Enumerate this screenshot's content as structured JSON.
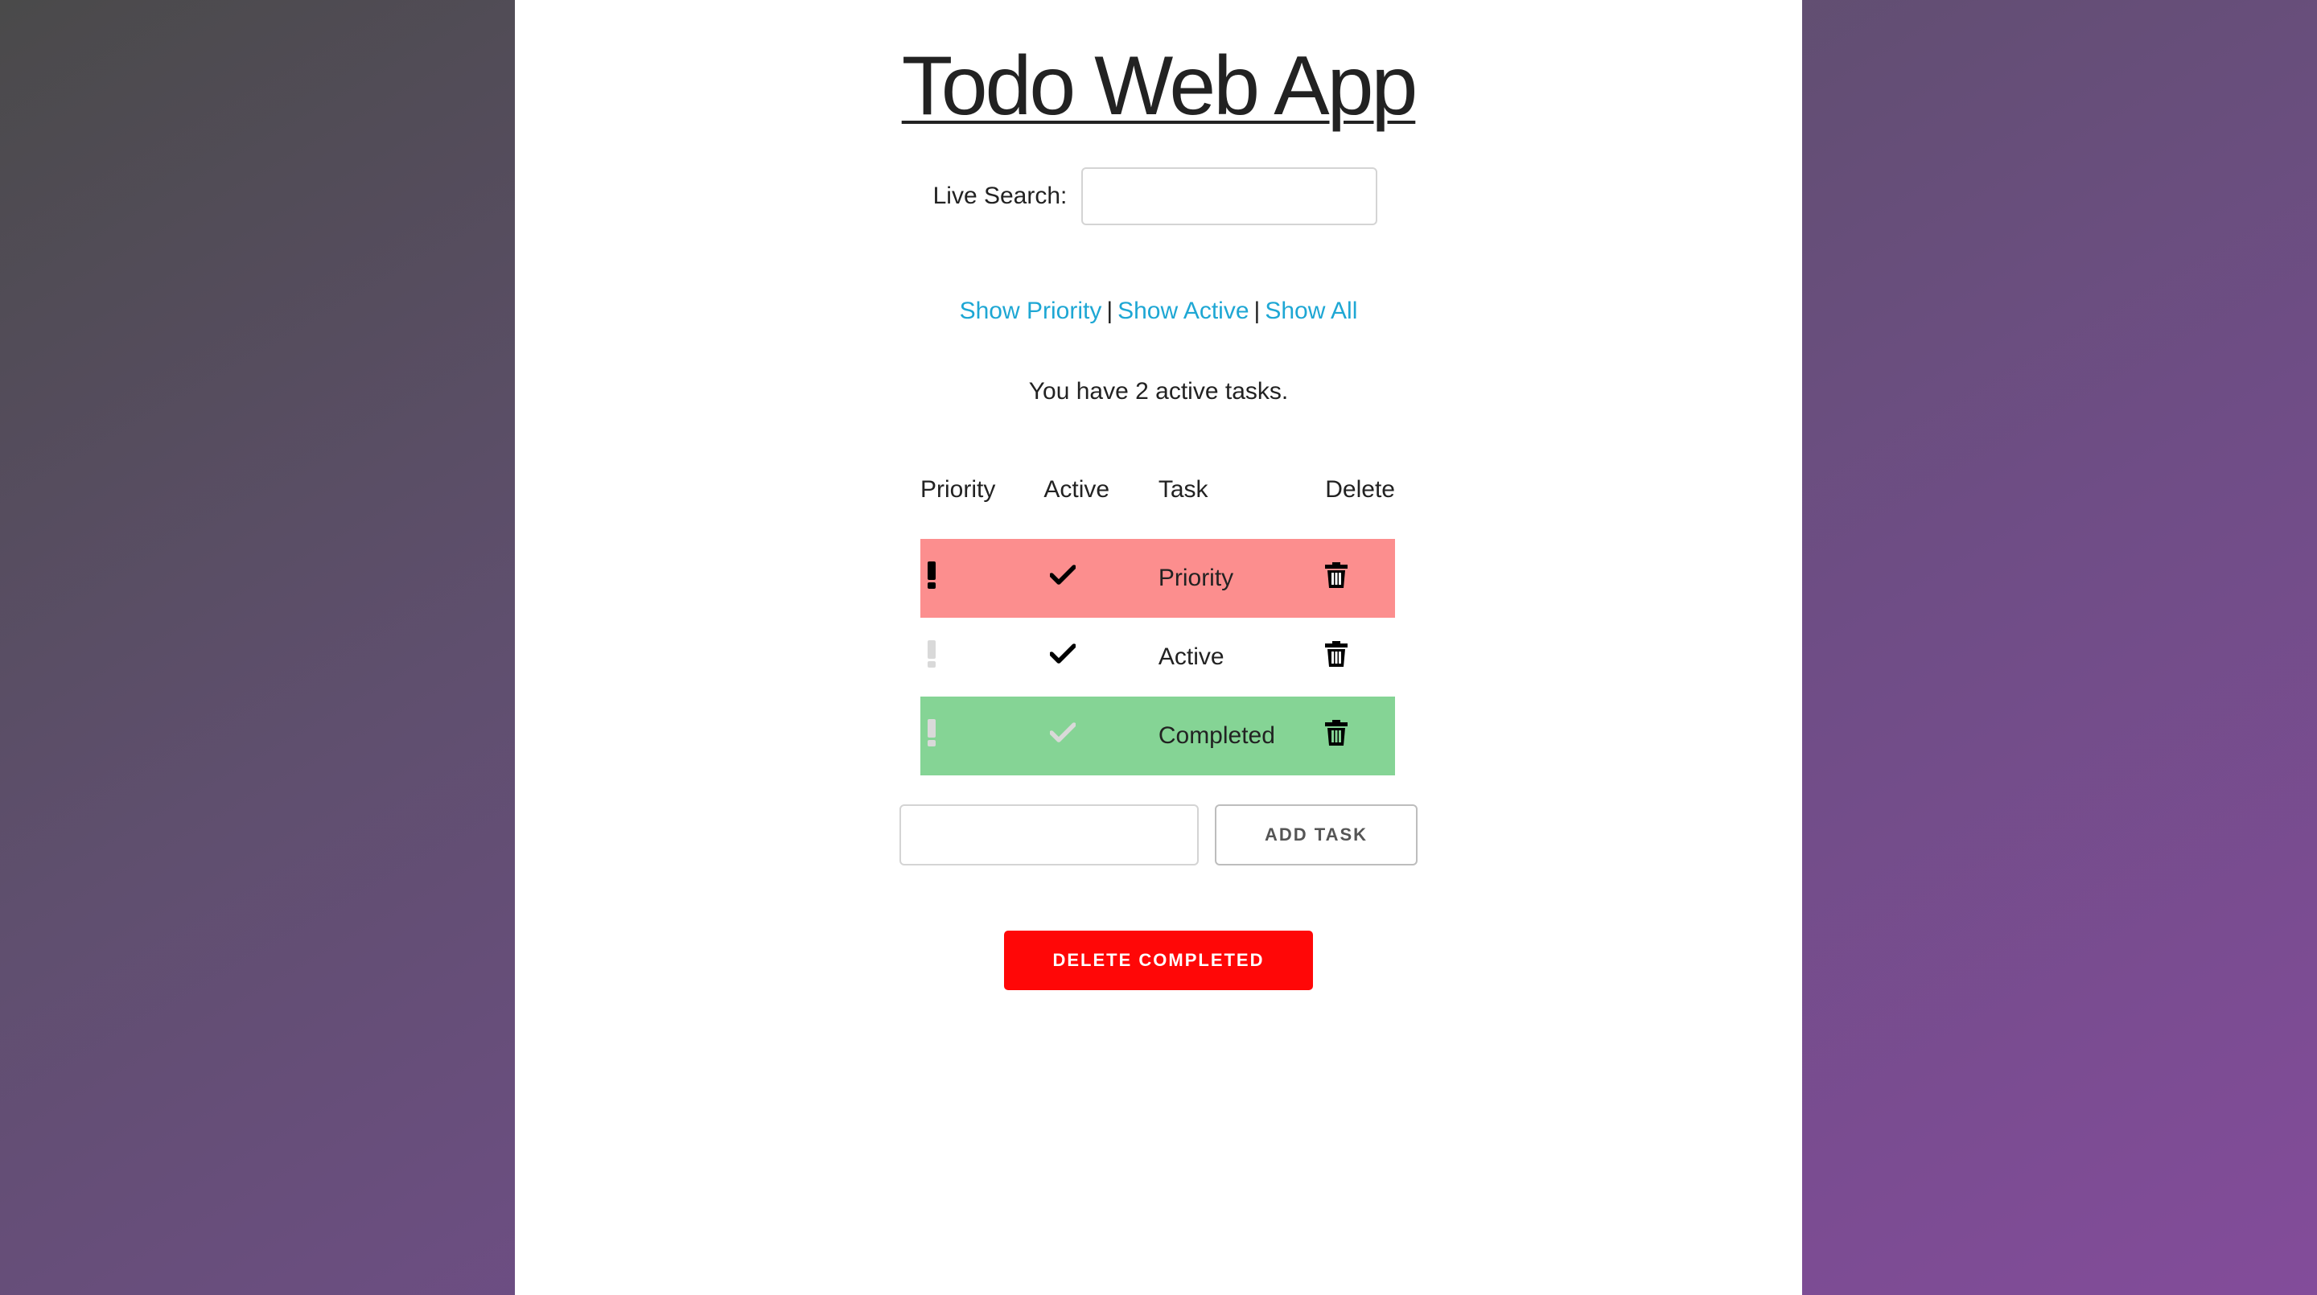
{
  "app": {
    "title": "Todo Web App"
  },
  "search": {
    "label": "Live Search:",
    "value": "",
    "placeholder": ""
  },
  "filters": {
    "show_priority": "Show Priority",
    "separator": "|",
    "show_active": "Show Active",
    "show_all": "Show All"
  },
  "summary": {
    "text": "You have 2 active tasks."
  },
  "table": {
    "headers": {
      "priority": "Priority",
      "active": "Active",
      "task": "Task",
      "delete": "Delete"
    },
    "rows": [
      {
        "task": "Priority",
        "priority": true,
        "active": true,
        "row_color": "#fc8e8e"
      },
      {
        "task": "Active",
        "priority": false,
        "active": true,
        "row_color": "#ffffff"
      },
      {
        "task": "Completed",
        "priority": false,
        "active": false,
        "row_color": "#85d495"
      }
    ]
  },
  "add": {
    "value": "",
    "placeholder": "",
    "button_label": "ADD TASK"
  },
  "actions": {
    "delete_completed_label": "DELETE COMPLETED"
  },
  "colors": {
    "link": "#1ea7d4",
    "priority_row": "#fc8e8e",
    "completed_row": "#85d495",
    "danger": "#ff0707",
    "icon_on": "#000000",
    "icon_off": "#d9d9d9"
  },
  "icons": {
    "priority": "exclamation-icon",
    "active": "checkmark-icon",
    "delete": "trash-icon"
  }
}
